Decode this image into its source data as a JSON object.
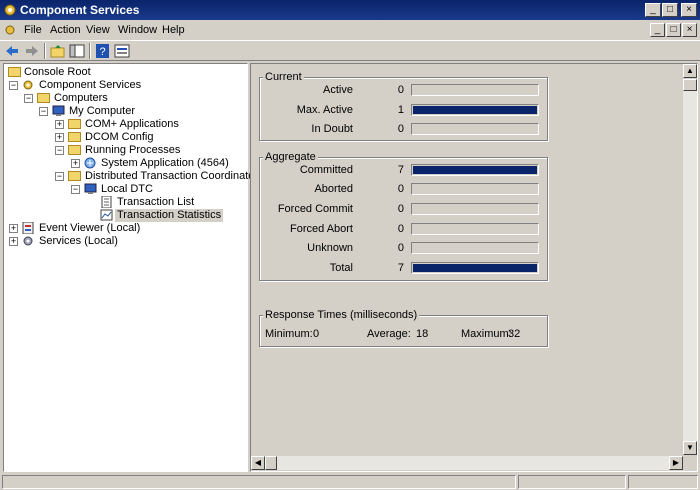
{
  "window": {
    "title": "Component Services",
    "caption_buttons": {
      "minimize": "_",
      "maximize": "□",
      "close": "×"
    }
  },
  "menu": [
    "File",
    "Action",
    "View",
    "Window",
    "Help"
  ],
  "tree": {
    "console_root": "Console Root",
    "component_services": "Component Services",
    "computers": "Computers",
    "my_computer": "My Computer",
    "com_apps": "COM+ Applications",
    "dcom_config": "DCOM Config",
    "running_processes": "Running Processes",
    "system_app": "System Application (4564)",
    "dtc": "Distributed Transaction Coordinator",
    "local_dtc": "Local DTC",
    "transaction_list": "Transaction List",
    "transaction_stats": "Transaction Statistics",
    "event_viewer": "Event Viewer (Local)",
    "services": "Services (Local)"
  },
  "current": {
    "title": "Current",
    "active": {
      "label": "Active",
      "value": "0",
      "fill": 0
    },
    "max_active": {
      "label": "Max. Active",
      "value": "1",
      "fill": 1
    },
    "in_doubt": {
      "label": "In Doubt",
      "value": "0",
      "fill": 0
    }
  },
  "aggregate": {
    "title": "Aggregate",
    "committed": {
      "label": "Committed",
      "value": "7",
      "fill": 1
    },
    "aborted": {
      "label": "Aborted",
      "value": "0",
      "fill": 0
    },
    "forced_commit": {
      "label": "Forced Commit",
      "value": "0",
      "fill": 0
    },
    "forced_abort": {
      "label": "Forced Abort",
      "value": "0",
      "fill": 0
    },
    "unknown": {
      "label": "Unknown",
      "value": "0",
      "fill": 0
    },
    "total": {
      "label": "Total",
      "value": "7",
      "fill": 1
    }
  },
  "response": {
    "title": "Response Times (milliseconds)",
    "min_label": "Minimum:",
    "min_value": "0",
    "avg_label": "Average:",
    "avg_value": "18",
    "max_label": "Maximum:",
    "max_value": "32"
  },
  "colors": {
    "title_bar": "#0a246a",
    "bar_fill": "#0a246a",
    "face": "#d4d0c8"
  }
}
